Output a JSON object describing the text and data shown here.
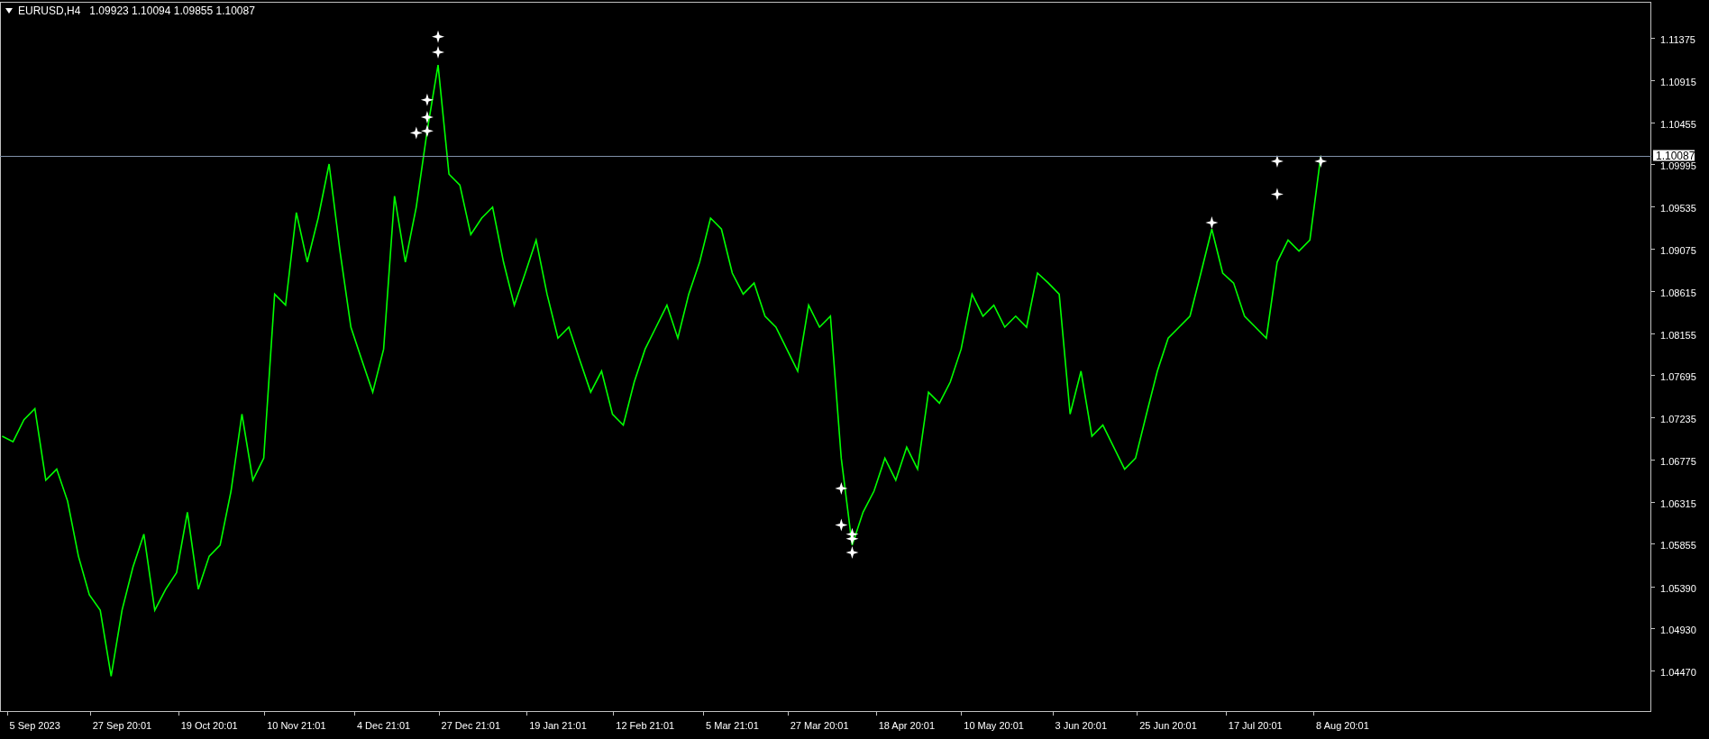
{
  "header": {
    "title": "EURUSD,H4",
    "quote": "1.09923 1.10094 1.09855 1.10087"
  },
  "chart_data": {
    "type": "line",
    "ylim": [
      1.0402,
      1.1177
    ],
    "categories": [
      null,
      null,
      null,
      "5 Sep 2023",
      null,
      null,
      null,
      null,
      null,
      null,
      null,
      "27 Sep 20:01",
      null,
      null,
      null,
      null,
      null,
      null,
      null,
      "19 Oct 20:01",
      null,
      null,
      null,
      null,
      null,
      null,
      null,
      "10 Nov 21:01",
      null,
      null,
      null,
      null,
      null,
      null,
      null,
      "4 Dec 21:01",
      null,
      null,
      null,
      null,
      null,
      null,
      null,
      "27 Dec 21:01",
      null,
      null,
      null,
      null,
      null,
      null,
      null,
      "19 Jan 21:01",
      null,
      null,
      null,
      null,
      null,
      null,
      null,
      "12 Feb 21:01",
      null,
      null,
      null,
      null,
      null,
      null,
      null,
      "5 Mar 21:01",
      null,
      null,
      null,
      null,
      null,
      null,
      null,
      "27 Mar 20:01",
      null,
      null,
      null,
      null,
      null,
      null,
      null,
      "18 Apr 20:01",
      null,
      null,
      null,
      null,
      null,
      null,
      null,
      "10 May 20:01",
      null,
      null,
      null,
      null,
      null,
      null,
      null,
      "3 Jun 20:01",
      null,
      null,
      null,
      null,
      null,
      null,
      null,
      "25 Jun 20:01",
      null,
      null,
      null,
      null,
      null,
      null,
      null,
      "17 Jul 20:01",
      null,
      null,
      null,
      null,
      null,
      null,
      null,
      "8 Aug 20:01"
    ],
    "series": [
      {
        "color": "#00ff00",
        "values": [
          1.0703,
          1.0697,
          1.0721,
          1.0733,
          1.0655,
          1.0667,
          1.0632,
          1.0572,
          1.053,
          1.0513,
          1.0441,
          1.0513,
          1.056,
          1.0596,
          1.0513,
          1.0536,
          1.0554,
          1.062,
          1.0536,
          1.0572,
          1.0584,
          1.0643,
          1.0727,
          1.0655,
          1.0679,
          1.0858,
          1.0846,
          1.0947,
          1.0893,
          1.0941,
          1.1,
          1.0905,
          1.0822,
          1.0786,
          1.0751,
          1.0798,
          1.0965,
          1.0893,
          1.0953,
          1.1036,
          1.1108,
          1.0989,
          1.0977,
          1.0923,
          1.0941,
          1.0953,
          1.0893,
          1.0846,
          1.0881,
          1.0917,
          1.0858,
          1.081,
          1.0822,
          1.0786,
          1.0751,
          1.0774,
          1.0727,
          1.0715,
          1.0762,
          1.0798,
          1.0822,
          1.0846,
          1.081,
          1.0858,
          1.0893,
          1.0941,
          1.0929,
          1.0881,
          1.0858,
          1.087,
          1.0834,
          1.0822,
          1.0798,
          1.0774,
          1.0846,
          1.0822,
          1.0834,
          1.0679,
          1.0584,
          1.062,
          1.0643,
          1.0679,
          1.0655,
          1.0691,
          1.0667,
          1.0751,
          1.0739,
          1.0762,
          1.0798,
          1.0858,
          1.0834,
          1.0846,
          1.0822,
          1.0834,
          1.0822,
          1.0881,
          1.087,
          1.0858,
          1.0727,
          1.0774,
          1.0703,
          1.0715,
          1.0691,
          1.0667,
          1.0679,
          1.0727,
          1.0774,
          1.081,
          1.0822,
          1.0834,
          1.0881,
          1.0929,
          1.0881,
          1.087,
          1.0834,
          1.0822,
          1.081,
          1.0893,
          1.0917,
          1.0905,
          1.0917,
          1.1009,
          null,
          null
        ]
      },
      {
        "type": "scatter",
        "color": "#ffffff",
        "values": [
          null,
          null,
          null,
          null,
          null,
          null,
          null,
          null,
          null,
          null,
          null,
          null,
          null,
          null,
          null,
          null,
          null,
          null,
          null,
          null,
          null,
          null,
          null,
          null,
          null,
          null,
          null,
          null,
          null,
          null,
          null,
          null,
          null,
          null,
          null,
          null,
          null,
          null,
          1.1034,
          null,
          1.1139,
          null,
          null,
          null,
          null,
          null,
          null,
          null,
          null,
          null,
          null,
          null,
          null,
          null,
          null,
          null,
          null,
          null,
          null,
          null,
          null,
          null,
          null,
          null,
          null,
          null,
          null,
          null,
          null,
          null,
          null,
          null,
          null,
          null,
          null,
          null,
          null,
          1.0646,
          null,
          null,
          null,
          null,
          null,
          null,
          null,
          null,
          null,
          null,
          null,
          null,
          null,
          null,
          null,
          null,
          null,
          null,
          null,
          null,
          null,
          null,
          null,
          null,
          null,
          null,
          null,
          null,
          null,
          null,
          null,
          null,
          null,
          1.0936,
          null,
          null,
          null,
          null,
          null,
          1.1003,
          null,
          null,
          null,
          1.1003,
          null,
          null
        ]
      },
      {
        "type": "scatter",
        "color": "#ffffff",
        "values": [
          null,
          null,
          null,
          null,
          null,
          null,
          null,
          null,
          null,
          null,
          null,
          null,
          null,
          null,
          null,
          null,
          null,
          null,
          null,
          null,
          null,
          null,
          null,
          null,
          null,
          null,
          null,
          null,
          null,
          null,
          null,
          null,
          null,
          null,
          null,
          null,
          null,
          null,
          null,
          1.1051,
          null,
          null,
          null,
          null,
          null,
          null,
          null,
          null,
          null,
          null,
          null,
          null,
          null,
          null,
          null,
          null,
          null,
          null,
          null,
          null,
          null,
          null,
          null,
          null,
          null,
          null,
          null,
          null,
          null,
          null,
          null,
          null,
          null,
          null,
          null,
          null,
          null,
          null,
          1.0576,
          null,
          null,
          null,
          null,
          null,
          null,
          null,
          null,
          null,
          null,
          null,
          null,
          null,
          null,
          null,
          null,
          null,
          null,
          null,
          null,
          null,
          null,
          null,
          null,
          null,
          null,
          null,
          null,
          null,
          null,
          null,
          null,
          null,
          null,
          null,
          null,
          null,
          null,
          1.0967,
          null,
          null,
          null,
          null,
          null,
          null
        ]
      },
      {
        "type": "scatter",
        "color": "#ffffff",
        "values": [
          null,
          null,
          null,
          null,
          null,
          null,
          null,
          null,
          null,
          null,
          null,
          null,
          null,
          null,
          null,
          null,
          null,
          null,
          null,
          null,
          null,
          null,
          null,
          null,
          null,
          null,
          null,
          null,
          null,
          null,
          null,
          null,
          null,
          null,
          null,
          null,
          null,
          null,
          null,
          null,
          1.1122,
          null,
          null,
          null,
          null,
          null,
          null,
          null,
          null,
          null,
          null,
          null,
          null,
          null,
          null,
          null,
          null,
          null,
          null,
          null,
          null,
          null,
          null,
          null,
          null,
          null,
          null,
          null,
          null,
          null,
          null,
          null,
          null,
          null,
          null,
          null,
          null,
          1.0606,
          null,
          null,
          null,
          null,
          null,
          null,
          null,
          null,
          null,
          null,
          null,
          null,
          null,
          null,
          null,
          null,
          null,
          null,
          null,
          null,
          null,
          null,
          null,
          null,
          null,
          null,
          null,
          null,
          null,
          null,
          null,
          null,
          null,
          null,
          null,
          null,
          null,
          null,
          null,
          null,
          null,
          null,
          null,
          null,
          null,
          null
        ]
      },
      {
        "type": "scatter",
        "color": "#ffffff",
        "values": [
          null,
          null,
          null,
          null,
          null,
          null,
          null,
          null,
          null,
          null,
          null,
          null,
          null,
          null,
          null,
          null,
          null,
          null,
          null,
          null,
          null,
          null,
          null,
          null,
          null,
          null,
          null,
          null,
          null,
          null,
          null,
          null,
          null,
          null,
          null,
          null,
          null,
          null,
          null,
          1.1036,
          null,
          null,
          null,
          null,
          null,
          null,
          null,
          null,
          null,
          null,
          null,
          null,
          null,
          null,
          null,
          null,
          null,
          null,
          null,
          null,
          null,
          null,
          null,
          null,
          null,
          null,
          null,
          null,
          null,
          null,
          null,
          null,
          null,
          null,
          null,
          null,
          null,
          null,
          1.0591,
          null,
          null,
          null,
          null,
          null,
          null,
          null,
          null,
          null,
          null,
          null,
          null,
          null,
          null,
          null,
          null,
          null,
          null,
          null,
          null,
          null,
          null,
          null,
          null,
          null,
          null,
          null,
          null,
          null,
          null,
          null,
          null,
          null,
          null,
          null,
          null,
          null,
          null,
          null,
          null,
          null,
          null,
          null,
          null,
          null
        ]
      },
      {
        "type": "scatter",
        "color": "#ffffff",
        "values": [
          null,
          null,
          null,
          null,
          null,
          null,
          null,
          null,
          null,
          null,
          null,
          null,
          null,
          null,
          null,
          null,
          null,
          null,
          null,
          null,
          null,
          null,
          null,
          null,
          null,
          null,
          null,
          null,
          null,
          null,
          null,
          null,
          null,
          null,
          null,
          null,
          null,
          null,
          null,
          1.107,
          null,
          null,
          null,
          null,
          null,
          null,
          null,
          null,
          null,
          null,
          null,
          null,
          null,
          null,
          null,
          null,
          null,
          null,
          null,
          null,
          null,
          null,
          null,
          null,
          null,
          null,
          null,
          null,
          null,
          null,
          null,
          null,
          null,
          null,
          null,
          null,
          null,
          null,
          1.0596,
          null,
          null,
          null,
          null,
          null,
          null,
          null,
          null,
          null,
          null,
          null,
          null,
          null,
          null,
          null,
          null,
          null,
          null,
          null,
          null,
          null,
          null,
          null,
          null,
          null,
          null,
          null,
          null,
          null,
          null,
          null,
          null,
          null,
          null,
          null,
          null,
          null,
          null,
          null,
          null,
          null,
          null,
          null,
          null,
          null
        ]
      }
    ],
    "yticks": [
      {
        "value": 1.11375,
        "label": "1.11375"
      },
      {
        "value": 1.10915,
        "label": "1.10915"
      },
      {
        "value": 1.10455,
        "label": "1.10455"
      },
      {
        "value": 1.09995,
        "label": "1.09995"
      },
      {
        "value": 1.09535,
        "label": "1.09535"
      },
      {
        "value": 1.09075,
        "label": "1.09075"
      },
      {
        "value": 1.08615,
        "label": "1.08615"
      },
      {
        "value": 1.08155,
        "label": "1.08155"
      },
      {
        "value": 1.07695,
        "label": "1.07695"
      },
      {
        "value": 1.07235,
        "label": "1.07235"
      },
      {
        "value": 1.06775,
        "label": "1.06775"
      },
      {
        "value": 1.06315,
        "label": "1.06315"
      },
      {
        "value": 1.05855,
        "label": "1.05855"
      },
      {
        "value": 1.0539,
        "label": "1.05390"
      },
      {
        "value": 1.0493,
        "label": "1.04930"
      },
      {
        "value": 1.0447,
        "label": "1.04470"
      }
    ],
    "ref_lines": [
      {
        "axis": "y",
        "value": 1.10087,
        "label": "1.10087"
      }
    ]
  }
}
